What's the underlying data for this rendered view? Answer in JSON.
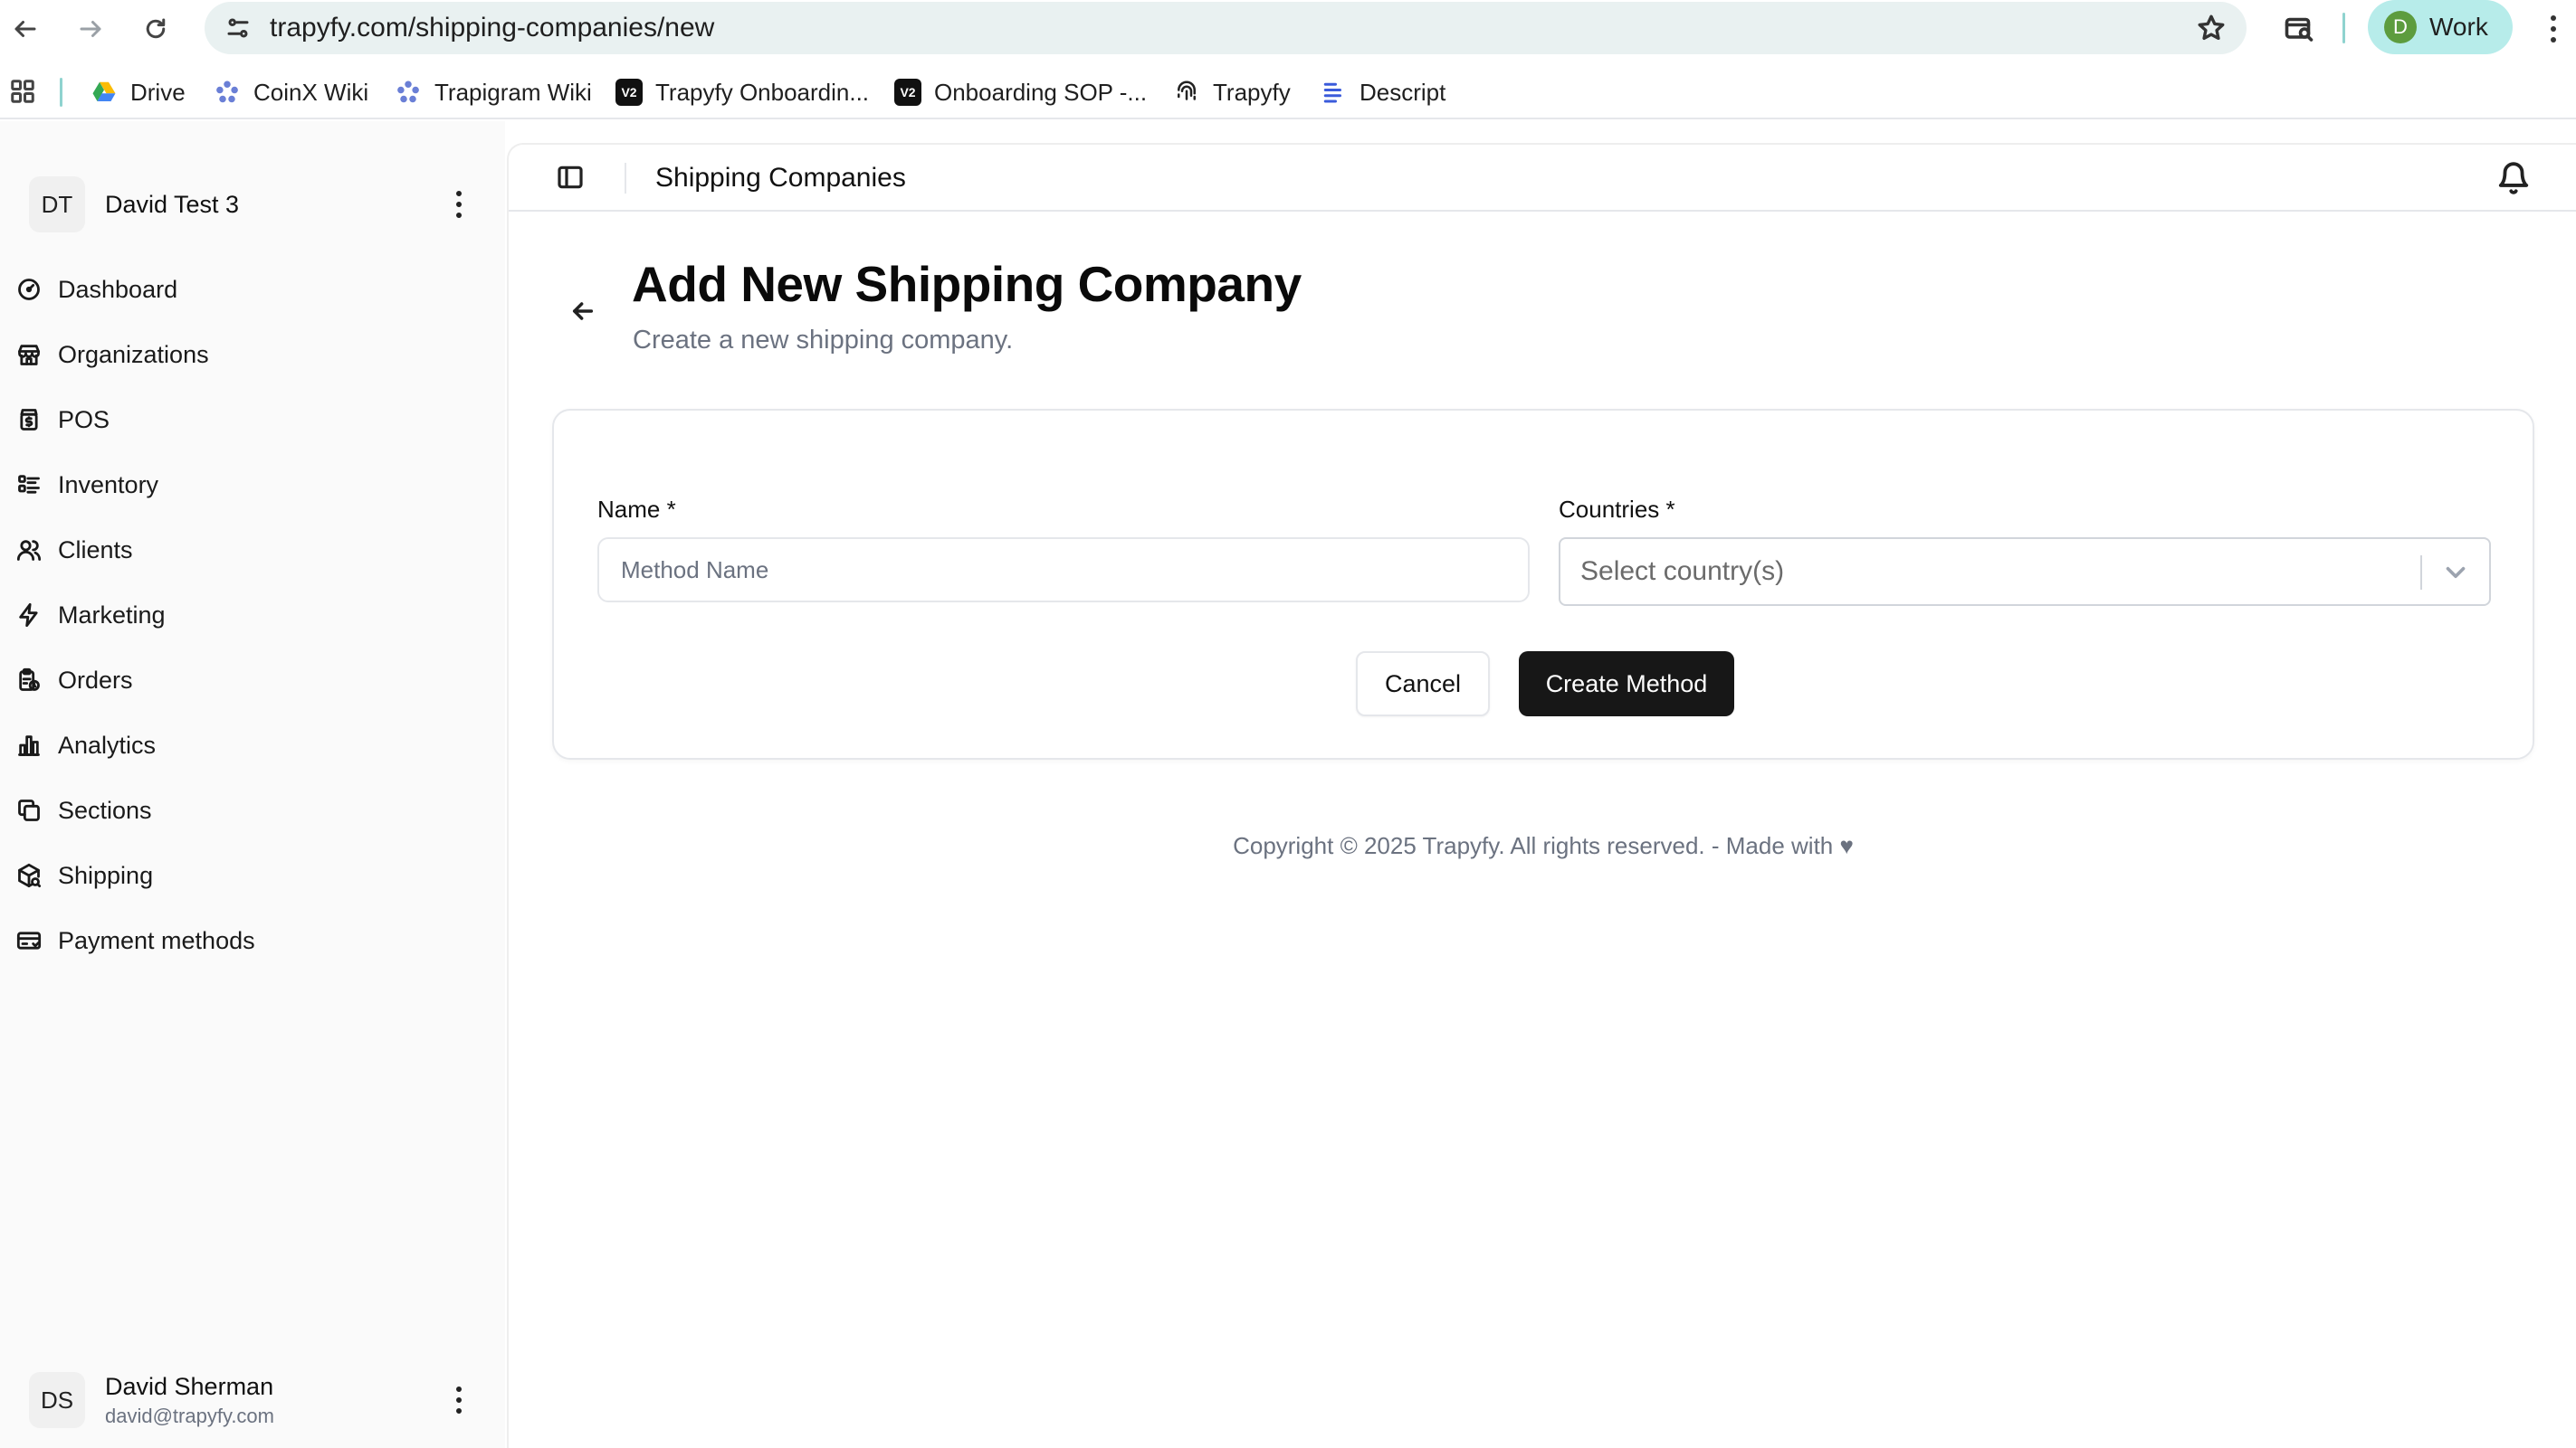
{
  "browser": {
    "url": "trapyfy.com/shipping-companies/new",
    "profile_initial": "D",
    "profile_label": "Work",
    "profile_color": "#5d9c3e"
  },
  "bookmarks": [
    {
      "label": "Drive",
      "icon": "google-drive-icon"
    },
    {
      "label": "CoinX Wiki",
      "icon": "wiki-flower-icon"
    },
    {
      "label": "Trapigram Wiki",
      "icon": "wiki-flower-icon"
    },
    {
      "label": "Trapyfy Onboardin...",
      "icon": "dark-badge-icon"
    },
    {
      "label": "Onboarding SOP -...",
      "icon": "dark-badge-icon"
    },
    {
      "label": "Trapyfy",
      "icon": "fingerprint-icon"
    },
    {
      "label": "Descript",
      "icon": "descript-icon"
    }
  ],
  "sidebar": {
    "org": {
      "initials": "DT",
      "name": "David Test 3"
    },
    "items": [
      {
        "label": "Dashboard",
        "icon": "gauge-icon"
      },
      {
        "label": "Organizations",
        "icon": "store-icon"
      },
      {
        "label": "POS",
        "icon": "pos-icon"
      },
      {
        "label": "Inventory",
        "icon": "list-icon"
      },
      {
        "label": "Clients",
        "icon": "users-icon"
      },
      {
        "label": "Marketing",
        "icon": "zap-icon"
      },
      {
        "label": "Orders",
        "icon": "clipboard-icon"
      },
      {
        "label": "Analytics",
        "icon": "bar-chart-icon"
      },
      {
        "label": "Sections",
        "icon": "copy-icon"
      },
      {
        "label": "Shipping",
        "icon": "package-icon"
      },
      {
        "label": "Payment methods",
        "icon": "card-icon"
      }
    ],
    "user": {
      "initials": "DS",
      "name": "David Sherman",
      "email": "david@trapyfy.com"
    }
  },
  "topbar": {
    "title": "Shipping Companies"
  },
  "page": {
    "title": "Add New Shipping Company",
    "subtitle": "Create a new shipping company."
  },
  "form": {
    "name_label": "Name *",
    "name_placeholder": "Method Name",
    "name_value": "",
    "countries_label": "Countries *",
    "countries_placeholder": "Select country(s)",
    "cancel_label": "Cancel",
    "submit_label": "Create Method"
  },
  "footer": {
    "text": "Copyright © 2025 Trapyfy. All rights reserved. - Made with ♥"
  },
  "colors": {
    "accent": "#171717",
    "chip": "#b7ecea",
    "omnibox": "#e9f1f1"
  }
}
